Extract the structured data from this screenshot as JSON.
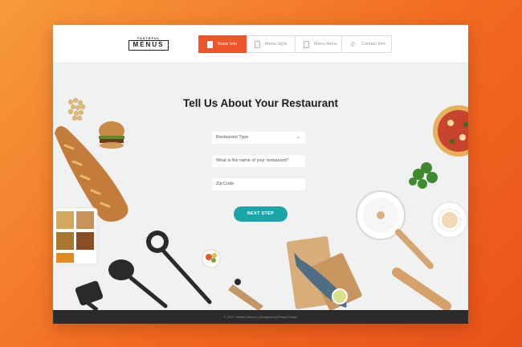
{
  "logo": {
    "top": "TASTEFUL",
    "main": "MENUS"
  },
  "steps": [
    {
      "label": "Basic Info",
      "icon": "document-icon"
    },
    {
      "label": "Menu Style",
      "icon": "document-icon"
    },
    {
      "label": "Menu Items",
      "icon": "document-icon"
    },
    {
      "label": "Contact Info",
      "icon": "phone-icon"
    }
  ],
  "active_step": 0,
  "main": {
    "title": "Tell Us About Your Restaurant",
    "restaurant_type_placeholder": "Restaurant Type",
    "restaurant_name_placeholder": "What is the name of your restaurant?",
    "zip_placeholder": "Zip Code",
    "next_label": "NEXT STEP"
  },
  "footer": {
    "text": "© 2017 Tasteful Menus | Designed by Pixpixl Studio"
  },
  "colors": {
    "accent": "#f0542a",
    "button": "#1aa6a9",
    "background": "#f26a21"
  }
}
